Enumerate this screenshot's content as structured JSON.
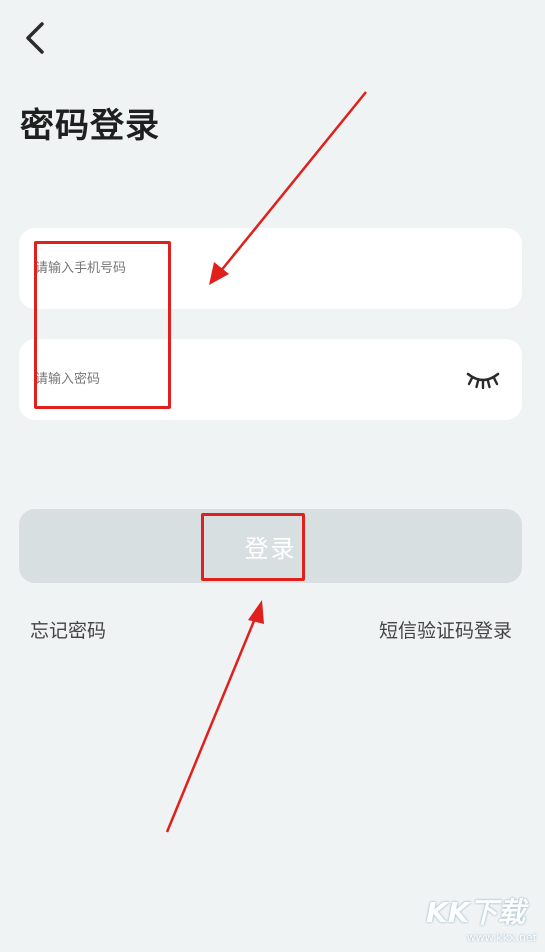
{
  "header": {
    "title": "密码登录"
  },
  "form": {
    "phone_placeholder": "请输入手机号码",
    "password_placeholder": "请输入密码",
    "login_label": "登录"
  },
  "links": {
    "forgot_password": "忘记密码",
    "sms_login": "短信验证码登录"
  },
  "icons": {
    "back": "chevron-left-icon",
    "password_toggle": "closed-eye-icon"
  },
  "watermark": {
    "logo": "KK下载",
    "url": "www.kkx.net"
  },
  "colors": {
    "background": "#eff3f4",
    "field": "#ffffff",
    "button_disabled": "#d8dfe1",
    "annotation": "#e0201c"
  }
}
